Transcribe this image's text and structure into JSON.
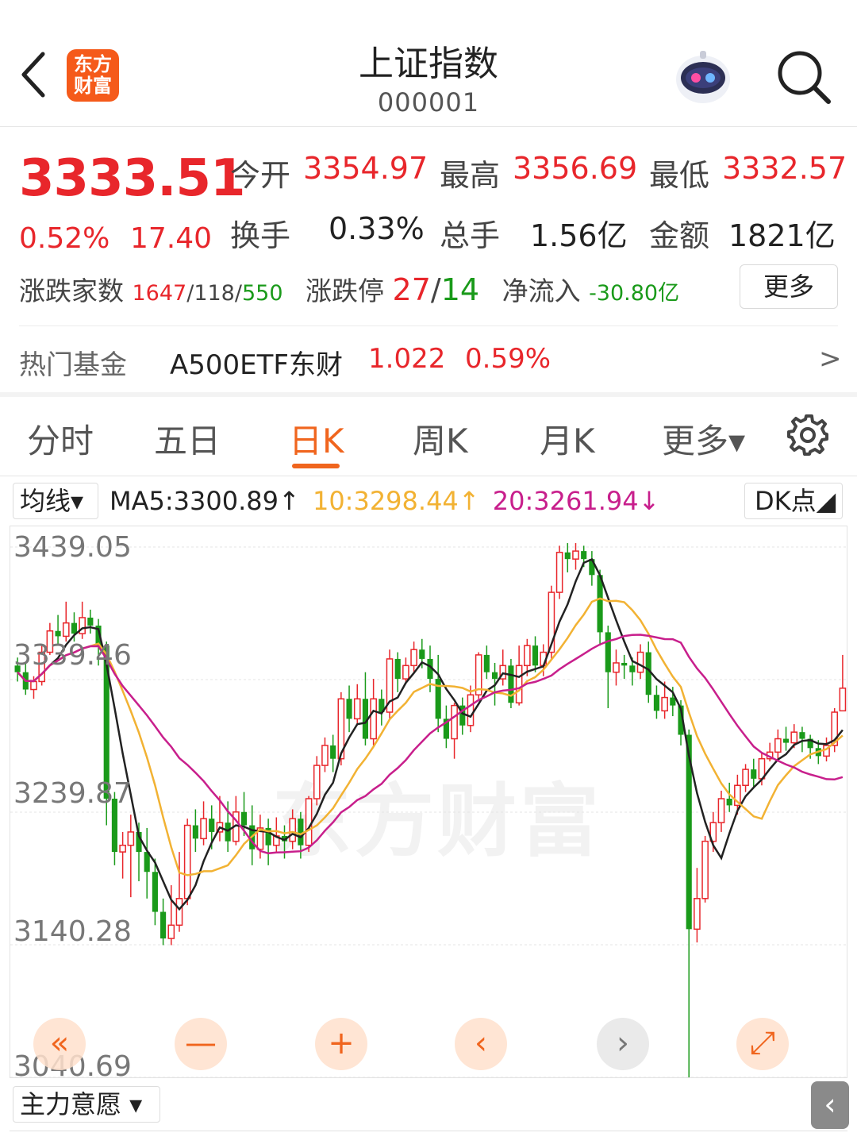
{
  "header": {
    "logo_line1": "东方",
    "logo_line2": "财富",
    "title": "上证指数",
    "code": "000001"
  },
  "quote": {
    "price": "3333.51",
    "change_pct": "0.52%",
    "change": "17.40",
    "open_label": "今开",
    "open_value": "3354.97",
    "high_label": "最高",
    "high_value": "3356.69",
    "low_label": "最低",
    "low_value": "3332.57",
    "turnover_label": "换手",
    "turnover_value": "0.33%",
    "volume_label": "总手",
    "volume_value": "1.56亿",
    "amount_label": "金额",
    "amount_value": "1821亿",
    "breadth_label": "涨跌家数",
    "breadth_up": "1647",
    "breadth_sep1": "/",
    "breadth_flat": "118",
    "breadth_sep2": "/",
    "breadth_down": "550",
    "limit_label": "涨跌停",
    "limit_up": "27",
    "limit_sep": "/",
    "limit_down": "14",
    "netflow_label": "净流入",
    "netflow_value": "-30.80亿",
    "more_label": "更多"
  },
  "hot_fund": {
    "label": "热门基金",
    "name": "A500ETF东财",
    "price": "1.022",
    "pct": "0.59%",
    "arrow": ">"
  },
  "tabs": [
    {
      "label": "分时"
    },
    {
      "label": "五日"
    },
    {
      "label": "日K"
    },
    {
      "label": "周K"
    },
    {
      "label": "月K"
    },
    {
      "label": "更多▾"
    }
  ],
  "ma": {
    "button": "均线▾",
    "ma5": "MA5:3300.89↑",
    "ma10": "10:3298.44↑",
    "ma20": "20:3261.94↓",
    "dk_button": "DK点◢"
  },
  "colors": {
    "up": "#e8262b",
    "down": "#1a9a1a",
    "accent": "#f0651e",
    "ma5": "#222222",
    "ma10": "#f2b233",
    "ma20": "#c81f8c"
  },
  "chart_data": {
    "type": "candlestick",
    "y_ticks": [
      "3439.05",
      "3339.46",
      "3239.87",
      "3140.28",
      "3040.69"
    ],
    "ylim": [
      3040.69,
      3439.05
    ],
    "watermark": "东方财富",
    "candles": [
      [
        3350,
        3345,
        3356,
        3338
      ],
      [
        3345,
        3332,
        3352,
        3328
      ],
      [
        3332,
        3338,
        3342,
        3325
      ],
      [
        3338,
        3360,
        3366,
        3335
      ],
      [
        3360,
        3376,
        3382,
        3358
      ],
      [
        3376,
        3372,
        3388,
        3366
      ],
      [
        3372,
        3382,
        3398,
        3368
      ],
      [
        3382,
        3374,
        3390,
        3368
      ],
      [
        3374,
        3386,
        3398,
        3370
      ],
      [
        3386,
        3380,
        3392,
        3374
      ],
      [
        3380,
        3365,
        3385,
        3350
      ],
      [
        3365,
        3250,
        3368,
        3230
      ],
      [
        3250,
        3210,
        3255,
        3200
      ],
      [
        3210,
        3215,
        3225,
        3190
      ],
      [
        3215,
        3225,
        3238,
        3176
      ],
      [
        3225,
        3210,
        3232,
        3188
      ],
      [
        3210,
        3195,
        3228,
        3175
      ],
      [
        3195,
        3165,
        3205,
        3155
      ],
      [
        3165,
        3145,
        3175,
        3140
      ],
      [
        3145,
        3155,
        3185,
        3140
      ],
      [
        3155,
        3175,
        3210,
        3150
      ],
      [
        3175,
        3230,
        3235,
        3170
      ],
      [
        3230,
        3220,
        3242,
        3210
      ],
      [
        3220,
        3235,
        3248,
        3215
      ],
      [
        3235,
        3225,
        3245,
        3212
      ],
      [
        3225,
        3232,
        3252,
        3218
      ],
      [
        3232,
        3218,
        3248,
        3210
      ],
      [
        3218,
        3240,
        3252,
        3215
      ],
      [
        3240,
        3230,
        3255,
        3222
      ],
      [
        3230,
        3212,
        3245,
        3200
      ],
      [
        3212,
        3228,
        3238,
        3205
      ],
      [
        3228,
        3215,
        3235,
        3200
      ],
      [
        3215,
        3222,
        3236,
        3210
      ],
      [
        3222,
        3218,
        3230,
        3205
      ],
      [
        3218,
        3235,
        3242,
        3212
      ],
      [
        3235,
        3215,
        3240,
        3205
      ],
      [
        3215,
        3250,
        3252,
        3210
      ],
      [
        3250,
        3275,
        3282,
        3245
      ],
      [
        3275,
        3290,
        3296,
        3270
      ],
      [
        3290,
        3280,
        3298,
        3270
      ],
      [
        3280,
        3325,
        3330,
        3275
      ],
      [
        3325,
        3310,
        3335,
        3300
      ],
      [
        3310,
        3325,
        3336,
        3305
      ],
      [
        3325,
        3295,
        3345,
        3290
      ],
      [
        3295,
        3325,
        3340,
        3290
      ],
      [
        3325,
        3315,
        3332,
        3305
      ],
      [
        3315,
        3355,
        3362,
        3310
      ],
      [
        3355,
        3340,
        3360,
        3330
      ],
      [
        3340,
        3350,
        3356,
        3336
      ],
      [
        3350,
        3362,
        3368,
        3345
      ],
      [
        3362,
        3355,
        3370,
        3348
      ],
      [
        3355,
        3340,
        3365,
        3330
      ],
      [
        3340,
        3310,
        3358,
        3300
      ],
      [
        3310,
        3295,
        3320,
        3288
      ],
      [
        3295,
        3320,
        3322,
        3280
      ],
      [
        3320,
        3305,
        3326,
        3298
      ],
      [
        3305,
        3328,
        3335,
        3300
      ],
      [
        3328,
        3358,
        3360,
        3325
      ],
      [
        3358,
        3345,
        3365,
        3340
      ],
      [
        3345,
        3340,
        3352,
        3320
      ],
      [
        3340,
        3350,
        3362,
        3335
      ],
      [
        3350,
        3322,
        3355,
        3318
      ],
      [
        3322,
        3350,
        3365,
        3320
      ],
      [
        3350,
        3365,
        3370,
        3342
      ],
      [
        3365,
        3350,
        3372,
        3345
      ],
      [
        3350,
        3360,
        3366,
        3342
      ],
      [
        3360,
        3405,
        3410,
        3355
      ],
      [
        3405,
        3435,
        3440,
        3400
      ],
      [
        3435,
        3430,
        3442,
        3420
      ],
      [
        3430,
        3436,
        3442,
        3422
      ],
      [
        3436,
        3430,
        3440,
        3424
      ],
      [
        3430,
        3418,
        3436,
        3410
      ],
      [
        3418,
        3375,
        3422,
        3365
      ],
      [
        3375,
        3345,
        3380,
        3318
      ],
      [
        3345,
        3352,
        3362,
        3335
      ],
      [
        3352,
        3350,
        3358,
        3340
      ],
      [
        3350,
        3345,
        3356,
        3335
      ],
      [
        3345,
        3360,
        3366,
        3340
      ],
      [
        3360,
        3328,
        3368,
        3322
      ],
      [
        3328,
        3316,
        3335,
        3310
      ],
      [
        3316,
        3326,
        3338,
        3310
      ],
      [
        3326,
        3320,
        3334,
        3312
      ],
      [
        3320,
        3298,
        3324,
        3290
      ],
      [
        3298,
        3152,
        3302,
        3035
      ],
      [
        3152,
        3175,
        3198,
        3142
      ],
      [
        3175,
        3218,
        3222,
        3172
      ],
      [
        3218,
        3232,
        3240,
        3210
      ],
      [
        3232,
        3250,
        3256,
        3225
      ],
      [
        3250,
        3245,
        3262,
        3240
      ],
      [
        3245,
        3260,
        3268,
        3238
      ],
      [
        3260,
        3272,
        3276,
        3255
      ],
      [
        3272,
        3265,
        3280,
        3258
      ],
      [
        3265,
        3280,
        3285,
        3260
      ],
      [
        3280,
        3285,
        3292,
        3278
      ],
      [
        3285,
        3295,
        3302,
        3280
      ],
      [
        3295,
        3292,
        3304,
        3286
      ],
      [
        3292,
        3300,
        3306,
        3288
      ],
      [
        3300,
        3295,
        3304,
        3285
      ],
      [
        3295,
        3288,
        3298,
        3280
      ],
      [
        3288,
        3282,
        3294,
        3276
      ],
      [
        3282,
        3290,
        3296,
        3278
      ],
      [
        3290,
        3315,
        3318,
        3285
      ],
      [
        3316,
        3333,
        3358,
        3316
      ]
    ]
  },
  "controls": {
    "rewind": "«",
    "zoom_out": "—",
    "zoom_in": "+",
    "prev": "‹",
    "next": "›",
    "expand": "⤢"
  },
  "indicator": {
    "button": "主力意愿 ▾",
    "collapse": "‹"
  }
}
